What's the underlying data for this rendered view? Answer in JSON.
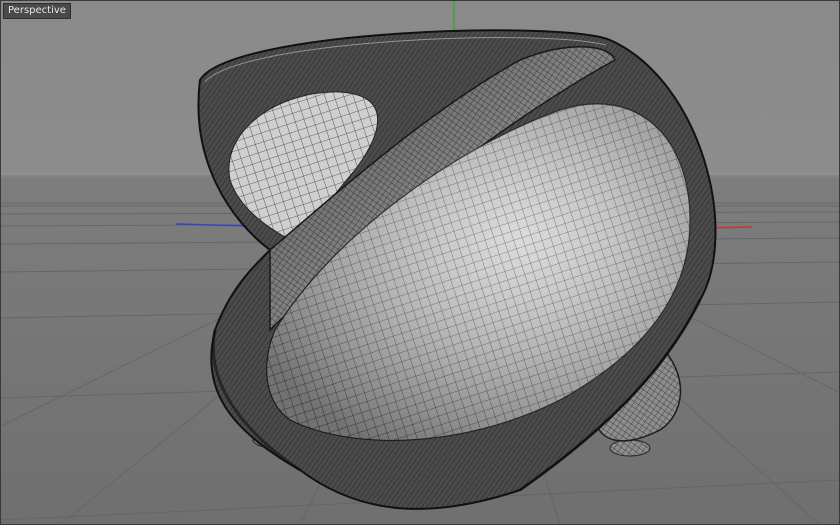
{
  "viewport": {
    "label": "Perspective",
    "colors": {
      "axis_x": "#c0392b",
      "axis_y": "#2eaa2e",
      "axis_z": "#3346c8",
      "background": "#8a8a8a",
      "grid": "#6a6a6a",
      "mesh_dark": "#2a2a2a",
      "mesh_light": "#d6d6d6"
    },
    "object": {
      "type": "wireframe-twisted-shell"
    }
  }
}
